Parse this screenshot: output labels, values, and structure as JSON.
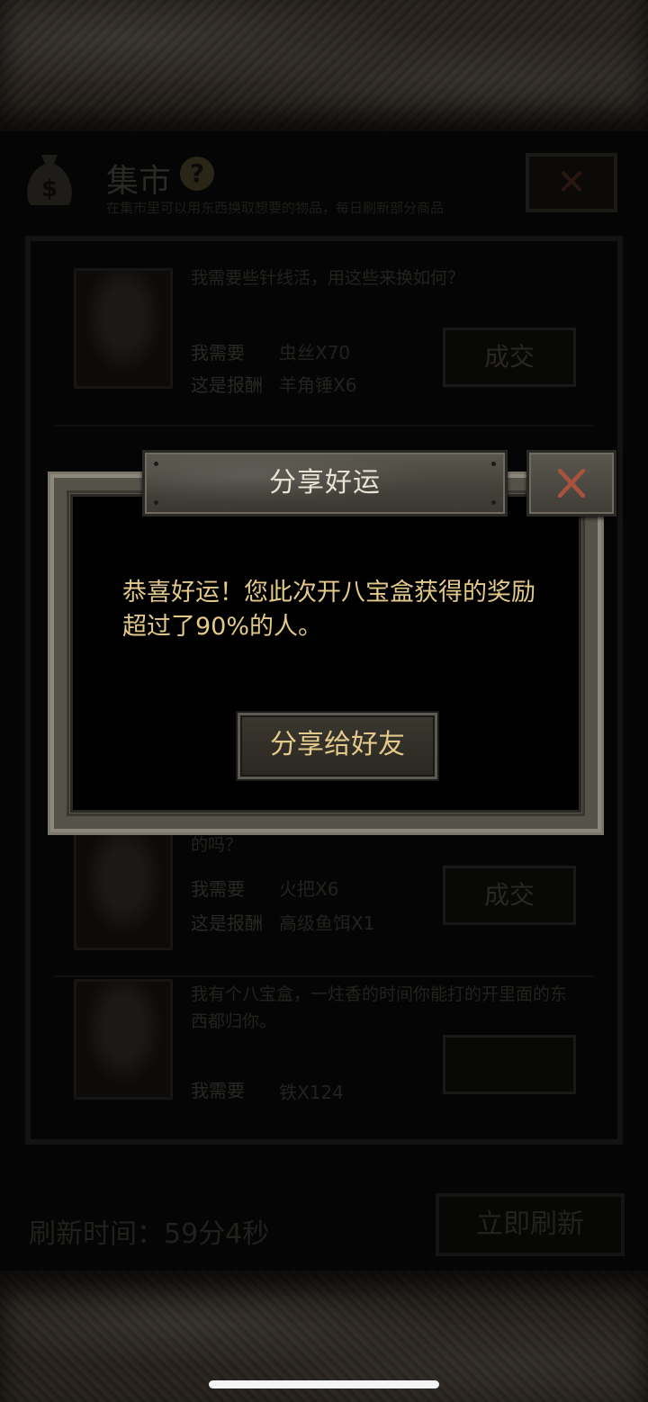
{
  "market": {
    "title": "集市",
    "help_label": "?",
    "subtitle": "在集市里可以用东西换取想要的物品，每日刷新部分商品",
    "close_label": "✕"
  },
  "trades": [
    {
      "description": "我需要些针线活，用这些来换如何？",
      "need_label": "我需要",
      "need_value": "虫丝X70",
      "reward_label": "这是报酬",
      "reward_value": "羊角锤X6",
      "deal_label": "成交"
    },
    {
      "description": "的吗？",
      "need_label": "我需要",
      "need_value": "火把X6",
      "reward_label": "这是报酬",
      "reward_value": "高级鱼饵X1",
      "deal_label": "成交"
    },
    {
      "description": "我有个八宝盒，一炷香的时间你能打的开里面的东西都归你。",
      "need_label": "我需要",
      "need_value": "铁X124",
      "deal_label": ""
    }
  ],
  "footer": {
    "refresh_time": "刷新时间：59分4秒",
    "refresh_button": "立即刷新"
  },
  "modal": {
    "title": "分享好运",
    "message": "恭喜好运！您此次开八宝盒获得的奖励超过了90%的人。",
    "share_button": "分享给好友"
  },
  "colors": {
    "accent_gold": "#e3c98a",
    "close_red": "#a8533c",
    "frame_gray": "#55524a"
  }
}
